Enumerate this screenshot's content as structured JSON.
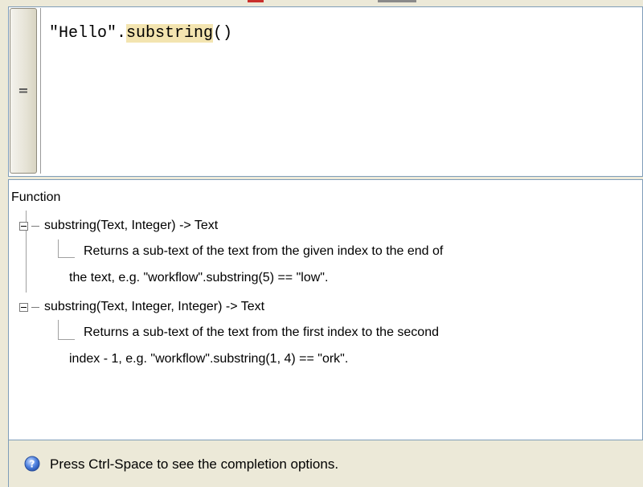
{
  "editor": {
    "handle_icon": "equals-icon",
    "handle_glyph": "=",
    "code_prefix": "\"Hello\".",
    "code_method": "substring",
    "code_suffix": "()"
  },
  "help": {
    "section_title": "Function",
    "entries": [
      {
        "signature": "substring(Text, Integer) -> Text",
        "description_line1": "Returns a sub-text of the text from the given index to the end of",
        "description_line2": "the text, e.g. \"workflow\".substring(5) == \"low\"."
      },
      {
        "signature": "substring(Text, Integer, Integer) -> Text",
        "description_line1": "Returns a sub-text of the text from the first index to the second",
        "description_line2": "index - 1, e.g. \"workflow\".substring(1, 4) == \"ork\"."
      }
    ],
    "expander_icon": "minus-icon"
  },
  "status": {
    "icon": "help-info-icon",
    "text": "Press Ctrl-Space to see the completion options."
  },
  "colors": {
    "window_bg": "#ece9d8",
    "border": "#7f9db9",
    "highlight": "#f3e4b0",
    "status_icon": "#3a6fd6"
  }
}
